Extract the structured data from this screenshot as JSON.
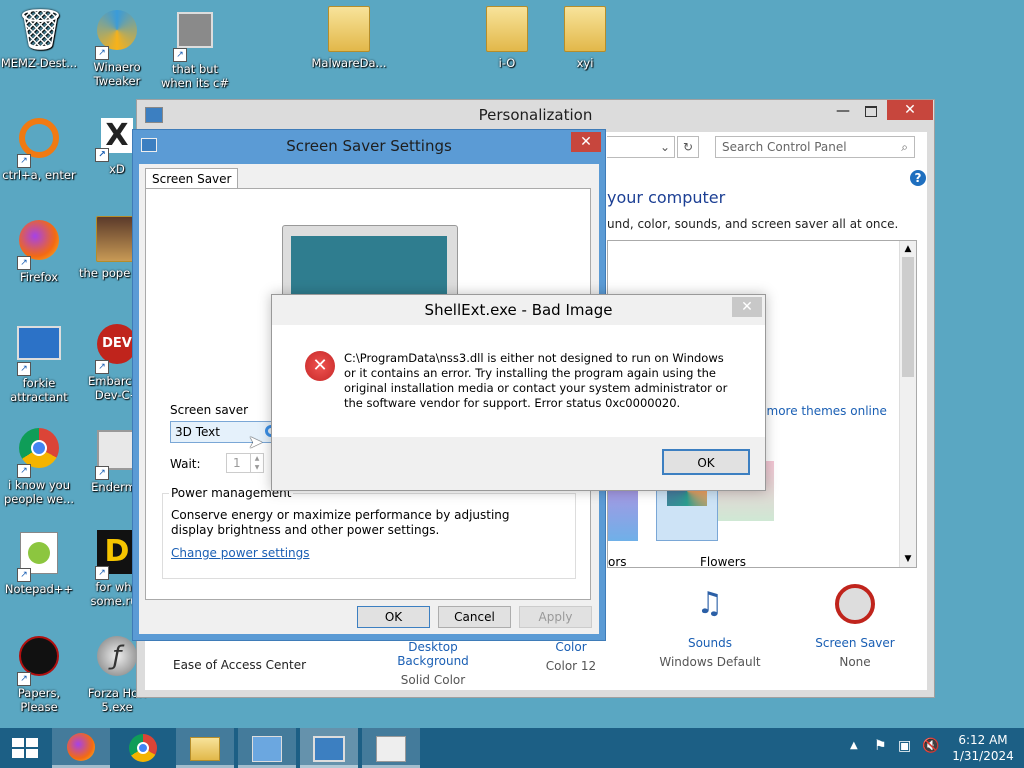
{
  "desktop": {
    "icons": [
      {
        "label": "MEMZ-Dest...",
        "glyph": "🗑",
        "name": "recycle-bin"
      },
      {
        "label": "Winaero Tweaker",
        "glyph": "◐",
        "name": "winaero"
      },
      {
        "label": "that but when its c#",
        "glyph": "▤",
        "name": "thatbut"
      },
      {
        "label": "MalwareDa...",
        "glyph": "",
        "name": "malwareda"
      },
      {
        "label": "i-O",
        "glyph": "",
        "name": "io"
      },
      {
        "label": "xyi",
        "glyph": "",
        "name": "xyi"
      },
      {
        "label": "ctrl+a, enter",
        "glyph": "◯",
        "name": "ctrla"
      },
      {
        "label": "xD",
        "glyph": "X",
        "name": "xd"
      },
      {
        "label": "Firefox",
        "glyph": "🦊",
        "name": "firefox"
      },
      {
        "label": "the pope shit",
        "glyph": "",
        "name": "pope"
      },
      {
        "label": "forkie attractant",
        "glyph": "⚙",
        "name": "forkie"
      },
      {
        "label": "Embarcad Dev-C+",
        "glyph": "DEV",
        "name": "embarcadero"
      },
      {
        "label": "i know you people we...",
        "glyph": "◉",
        "name": "chrome-desktop"
      },
      {
        "label": "Enderma",
        "glyph": "▦",
        "name": "enderman"
      },
      {
        "label": "Notepad++",
        "glyph": "✎",
        "name": "notepadpp"
      },
      {
        "label": "for whe some.rus",
        "glyph": "D",
        "name": "forwhe"
      },
      {
        "label": "Papers, Please",
        "glyph": "●",
        "name": "papers-please"
      },
      {
        "label": "Forza Hori 5.exe",
        "glyph": "ƒ",
        "name": "forza"
      }
    ]
  },
  "personalization": {
    "title": "Personalization",
    "search_placeholder": "Search Control Panel",
    "heading": "your computer",
    "subtext": "und, color, sounds, and screen saver all at once.",
    "more_themes": "t more themes online",
    "themes": [
      {
        "label": "ors"
      },
      {
        "label": "Flowers"
      }
    ],
    "bottom_items": [
      {
        "title": "Desktop Background",
        "value": "Solid Color"
      },
      {
        "title": "Color",
        "value": "Color 12"
      },
      {
        "title": "Sounds",
        "value": "Windows Default"
      },
      {
        "title": "Screen Saver",
        "value": "None"
      }
    ],
    "ease_access": "Ease of Access Center"
  },
  "screensaver": {
    "title": "Screen Saver Settings",
    "tab": "Screen Saver",
    "group_label": "Screen saver",
    "selected": "3D Text",
    "wait_label": "Wait:",
    "wait_value": "1",
    "power_label": "Power management",
    "power_text": "Conserve energy or maximize performance by adjusting display brightness and other power settings.",
    "power_link": "Change power settings",
    "ok": "OK",
    "cancel": "Cancel",
    "apply": "Apply"
  },
  "error_dialog": {
    "title": "ShellExt.exe - Bad Image",
    "message": "C:\\ProgramData\\nss3.dll is either not designed to run on Windows or it contains an error. Try installing the program again using the original installation media or contact your system administrator or the software vendor for support. Error status 0xc0000020.",
    "ok": "OK"
  },
  "taskbar": {
    "time": "6:12 AM",
    "date": "1/31/2024"
  },
  "colors": {
    "desktop": "#5aa7c2",
    "taskbar": "#1c5f85",
    "close": "#c7463d",
    "link": "#1a5fb4"
  }
}
